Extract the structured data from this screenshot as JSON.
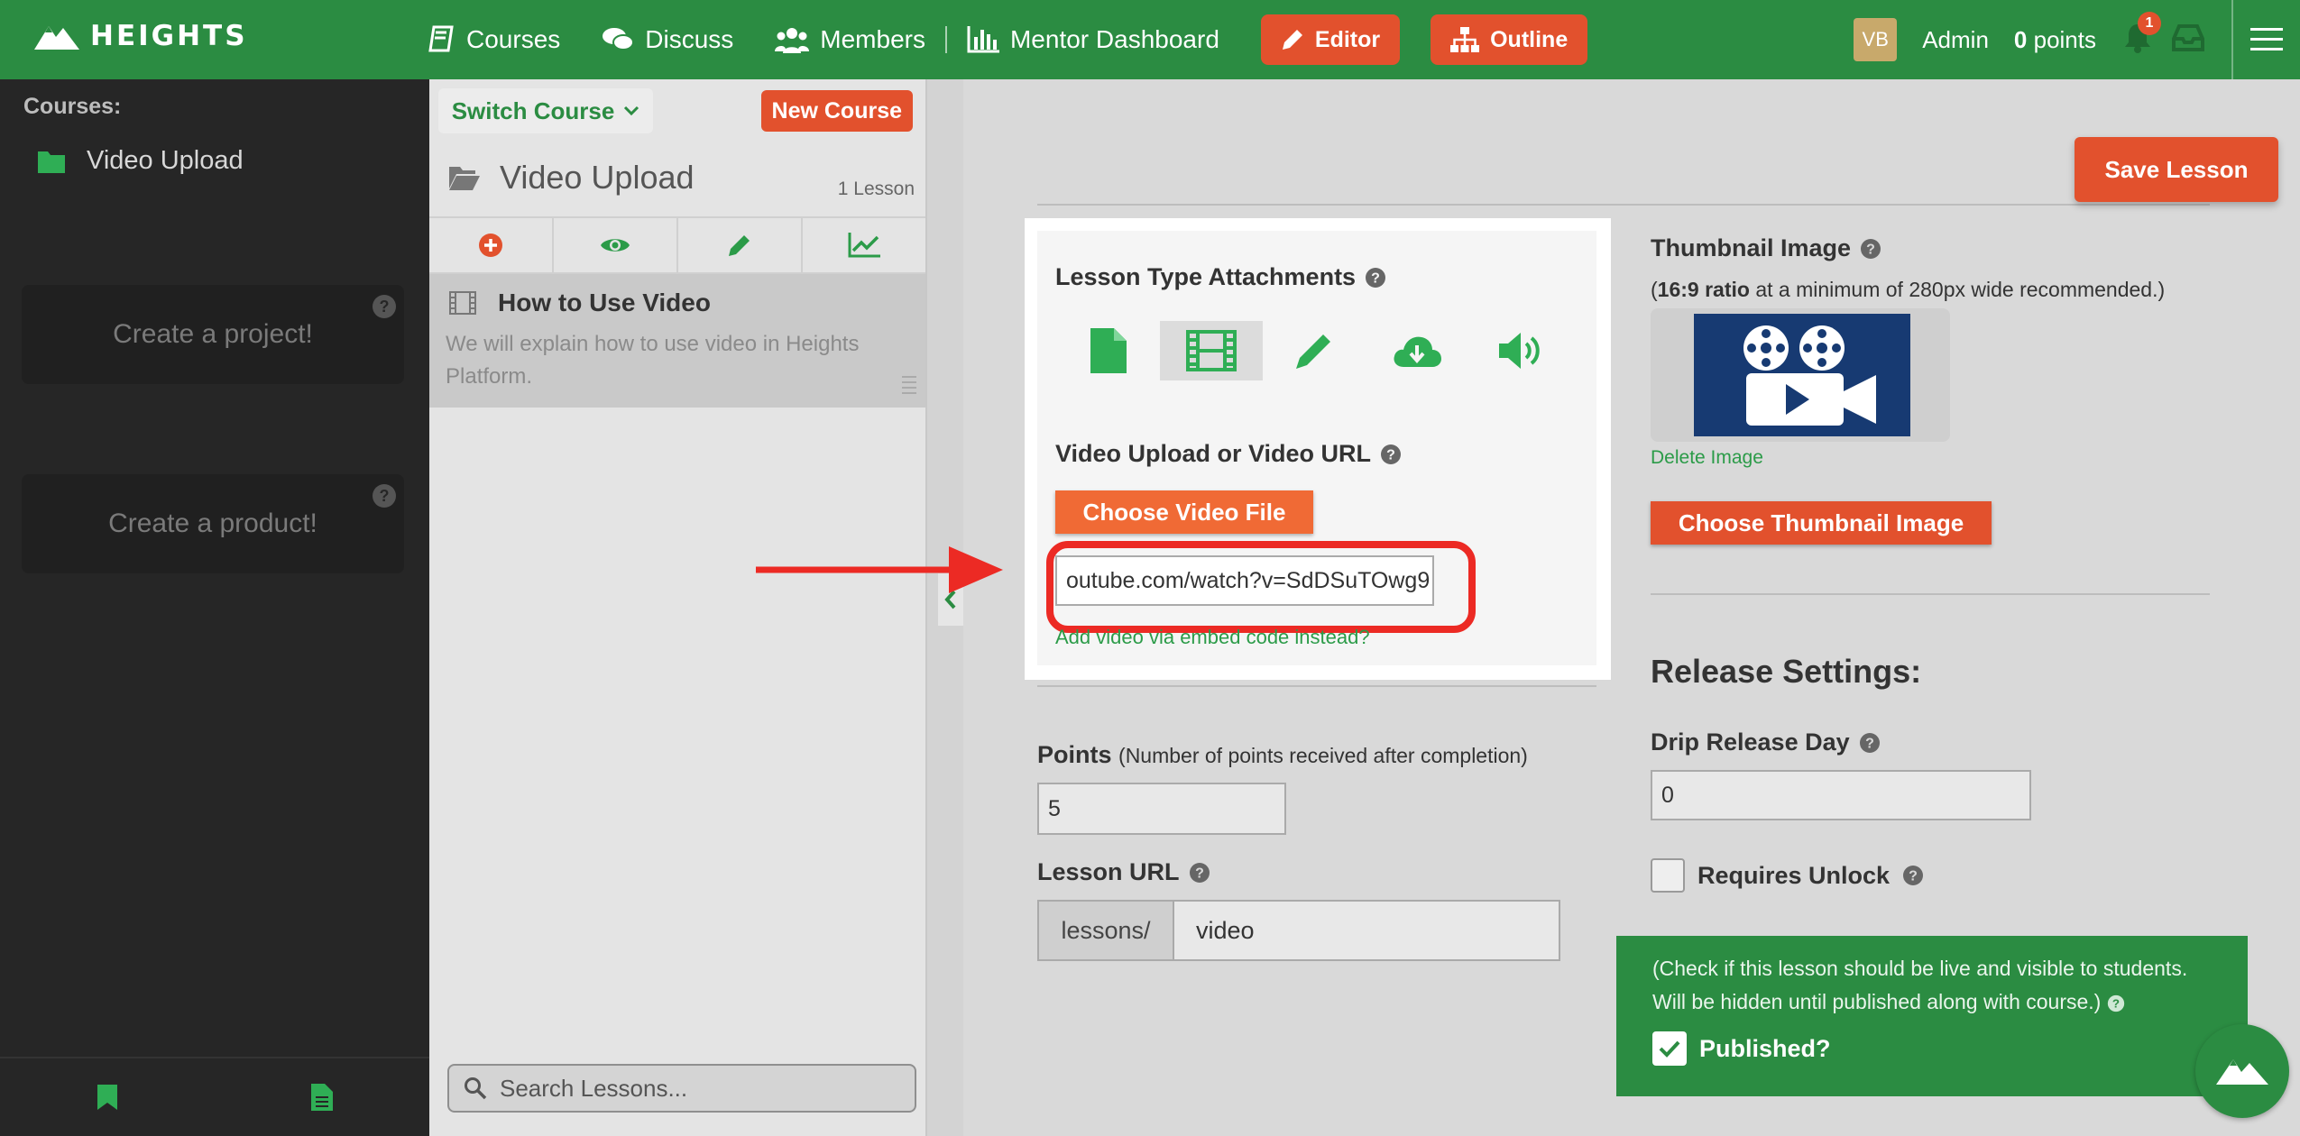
{
  "topbar": {
    "brand": "HEIGHTS",
    "nav": [
      "Courses",
      "Discuss",
      "Members",
      "Mentor Dashboard"
    ],
    "editor_label": "Editor",
    "outline_label": "Outline",
    "avatar_initials": "VB",
    "user_name": "Admin",
    "points_value": "0",
    "points_unit": "points",
    "notification_count": "1",
    "colors": {
      "bar": "#2b8c42",
      "accent": "#e2512d"
    }
  },
  "sidebar": {
    "title": "Courses:",
    "course": "Video Upload",
    "promo_project": "Create a project!",
    "promo_product": "Create a product!"
  },
  "lesson_panel": {
    "switch_course": "Switch Course",
    "new_course": "New Course",
    "course_title": "Video Upload",
    "lesson_count": "1 Lesson",
    "lesson": {
      "title": "How to Use Video",
      "description": "We will explain how to use video in Heights Platform."
    },
    "search_placeholder": "Search Lessons..."
  },
  "editor": {
    "save_lesson": "Save Lesson",
    "attachments_title": "Lesson Type Attachments",
    "attachment_types": [
      "document-icon",
      "film-icon",
      "pencil-icon",
      "cloud-download-icon",
      "speaker-icon"
    ],
    "video_label": "Video Upload or Video URL",
    "choose_video": "Choose Video File",
    "video_url": "outube.com/watch?v=SdDSuTOwg9",
    "embed_link": "Add video via embed code instead?",
    "points_label": "Points",
    "points_hint": "(Number of points received after completion)",
    "points_value": "5",
    "lesson_url_label": "Lesson URL",
    "lesson_url_prefix": "lessons/",
    "lesson_url_value": "video",
    "thumbnail_label": "Thumbnail Image",
    "thumbnail_hint_bold": "16:9 ratio",
    "thumbnail_hint_rest": " at a minimum of 280px wide recommended.)",
    "delete_image": "Delete Image",
    "choose_thumbnail": "Choose Thumbnail Image",
    "release_title": "Release Settings:",
    "drip_label": "Drip Release Day",
    "drip_value": "0",
    "requires_unlock": "Requires Unlock",
    "publish_note": "(Check if this lesson should be live and visible to students. Will be hidden until published along with course.)",
    "published_label": "Published?"
  }
}
